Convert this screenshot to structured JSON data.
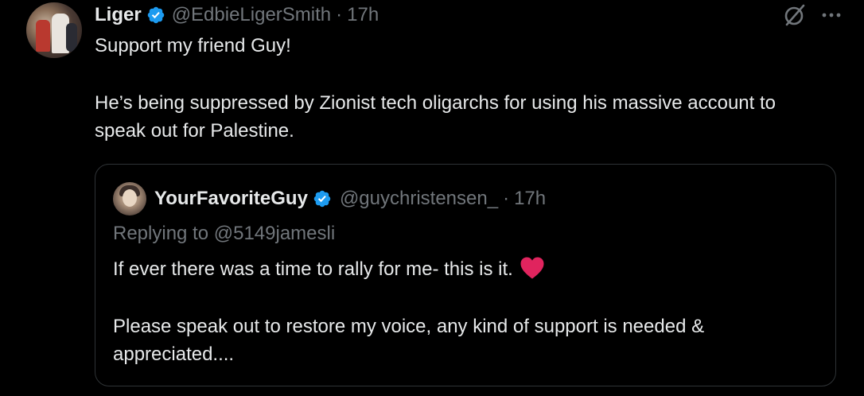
{
  "tweet": {
    "author_name": "Liger",
    "author_handle": "@EdbieLigerSmith",
    "separator": "·",
    "time": "17h",
    "text_line1": "Support my friend Guy!",
    "text_line2": "He’s being suppressed by Zionist tech oligarchs for using his massive account to speak out for Palestine.",
    "verified_icon": "verified-badge-icon",
    "grok_icon": "grok-icon",
    "more_icon": "more-icon"
  },
  "quote": {
    "author_name": "YourFavoriteGuy",
    "author_handle": "@guychristensen_",
    "separator": "·",
    "time": "17h",
    "replying_prefix": "Replying to ",
    "replying_mention": "@5149jamesli",
    "text_line1": "If ever there was a time to rally for me- this is it.",
    "text_line2": "Please speak out to restore my voice, any kind of support is needed & appreciated....",
    "emoji": "red-heart-icon"
  },
  "colors": {
    "background": "#000000",
    "text": "#e7e9ea",
    "secondary": "#71767b",
    "verified": "#1d9bf0",
    "border": "#2f3336",
    "heart": "#e0245e"
  }
}
